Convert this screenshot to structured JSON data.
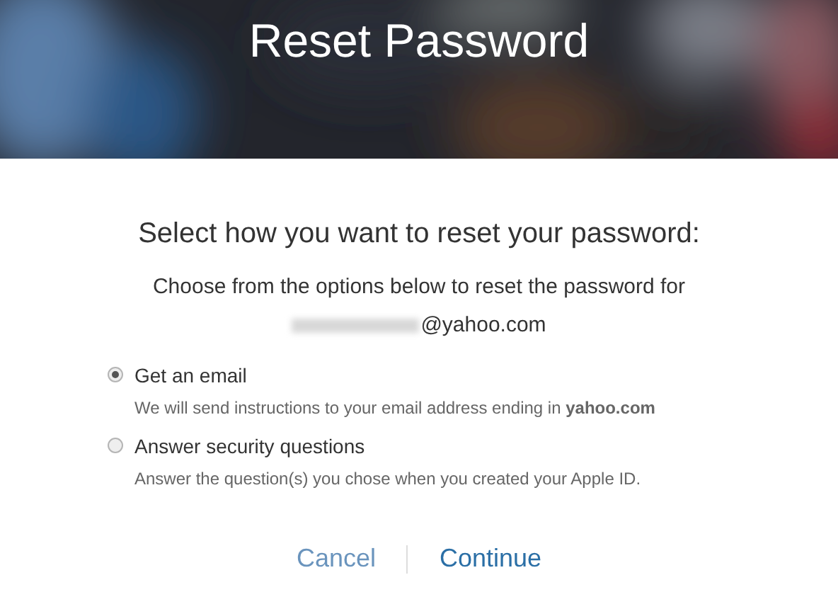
{
  "header": {
    "title": "Reset Password"
  },
  "prompt": "Select how you want to reset your password:",
  "instructions": "Choose from the options below to reset the password for",
  "account_email": "@yahoo.com",
  "options": [
    {
      "label": "Get an email",
      "description": "We will send instructions to your email address ending in **yahoo.com**",
      "selected": true
    },
    {
      "label": "Answer security questions",
      "description": "Answer the question(s) you chose when you created your Apple ID.",
      "selected": false
    }
  ],
  "actions": [
    {
      "label": "Cancel",
      "kind": "secondary"
    },
    {
      "label": "Continue",
      "kind": "primary"
    }
  ]
}
